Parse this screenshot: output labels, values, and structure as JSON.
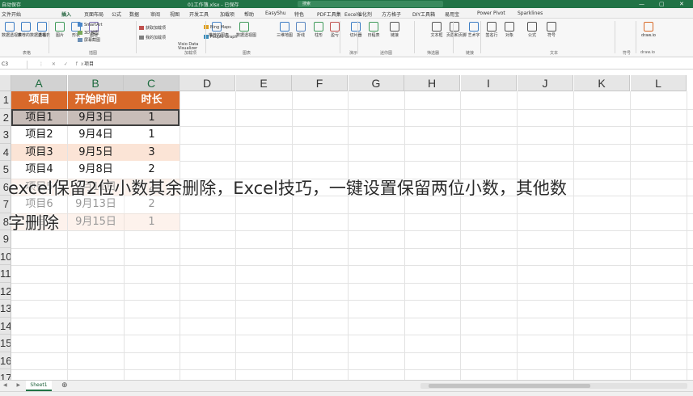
{
  "titlebar": {
    "left_text": "自动保存",
    "file_name": "01工作簿.xlsx - 已保存",
    "search_placeholder": "搜索",
    "minimize": "—",
    "restore": "▢",
    "close": "✕"
  },
  "tabs": [
    "文件",
    "开始",
    "插入",
    "页面布局",
    "公式",
    "数据",
    "审阅",
    "视图",
    "开发工具",
    "加载项",
    "帮助",
    "EasyShu",
    "特色",
    "PDF工具集",
    "Excel催化剂",
    "方方格子",
    "DIY工具箱",
    "易用宝",
    "Power Pivot",
    "Sparklines"
  ],
  "active_tab": "插入",
  "ribbon": {
    "buttons": [
      {
        "label": "数据透视表",
        "icon": "pivot-table-icon"
      },
      {
        "label": "推荐的数据透视表",
        "icon": "recommended-pivot-icon"
      },
      {
        "label": "表格",
        "icon": "table-icon"
      },
      {
        "label": "图片",
        "icon": "picture-icon"
      },
      {
        "label": "形状",
        "icon": "shapes-icon"
      },
      {
        "label": "图标",
        "icon": "icons-icon"
      },
      {
        "label": "推荐的图表",
        "icon": "recommended-chart-icon"
      },
      {
        "label": "数据透视图",
        "icon": "pivot-chart-icon"
      },
      {
        "label": "三维地图",
        "icon": "3d-map-icon"
      },
      {
        "label": "折线",
        "icon": "line-sparkline-icon"
      },
      {
        "label": "柱形",
        "icon": "column-sparkline-icon"
      },
      {
        "label": "盈亏",
        "icon": "winloss-sparkline-icon"
      },
      {
        "label": "切片器",
        "icon": "slicer-icon"
      },
      {
        "label": "日程表",
        "icon": "timeline-icon"
      },
      {
        "label": "链接",
        "icon": "link-icon"
      },
      {
        "label": "文本框",
        "icon": "textbox-icon"
      },
      {
        "label": "页眉和页脚",
        "icon": "header-footer-icon"
      },
      {
        "label": "艺术字",
        "icon": "wordart-icon"
      },
      {
        "label": "签名行",
        "icon": "signature-icon"
      },
      {
        "label": "对象",
        "icon": "object-icon"
      },
      {
        "label": "公式",
        "icon": "equation-icon"
      },
      {
        "label": "符号",
        "icon": "symbol-icon"
      },
      {
        "label": "draw.io",
        "icon": "drawio-icon"
      }
    ],
    "small_items": [
      "SmartArt",
      "3D 模型",
      "屏幕截图",
      "获取加载项",
      "我的加载项",
      "Visio Data Visualizer",
      "Bing Maps",
      "People Graph"
    ],
    "groups": [
      "表格",
      "插图",
      "加载项",
      "图表",
      "演示",
      "迷你图",
      "筛选器",
      "链接",
      "文本",
      "符号",
      "draw.io"
    ]
  },
  "formula_bar": {
    "name_box": "C3",
    "icons": "⋮ ✕ ✓ fx",
    "content": "项目"
  },
  "columns": [
    "A",
    "B",
    "C",
    "D",
    "E",
    "F",
    "G",
    "H",
    "I",
    "J",
    "K",
    "L"
  ],
  "rows": [
    "1",
    "2",
    "3",
    "4",
    "5",
    "6",
    "7",
    "8",
    "9",
    "10",
    "11",
    "12",
    "13",
    "14",
    "15",
    "16",
    "17"
  ],
  "table": {
    "headers": [
      "项目",
      "开始时间",
      "时长"
    ],
    "rows": [
      [
        "项目1",
        "9月3日",
        "1"
      ],
      [
        "项目2",
        "9月4日",
        "1"
      ],
      [
        "项目3",
        "9月5日",
        "3"
      ],
      [
        "项目4",
        "9月8日",
        "2"
      ],
      [
        "项目5",
        "9月11日",
        "2"
      ],
      [
        "项目6",
        "9月13日",
        "2"
      ],
      [
        "项目7",
        "9月15日",
        "1"
      ]
    ]
  },
  "caption": {
    "line1": "excel保留2位小数其余删除，Excel技巧，一键设置保留两位小数，其他数",
    "line2": "字删除"
  },
  "sheet": {
    "nav": "◀ ▶",
    "tab_name": "Sheet1",
    "add": "⊕"
  },
  "colors": {
    "excel_green": "#217346",
    "header_orange": "#d8692a",
    "row_peach": "#fbe4d6",
    "selected_row_grey": "#c8bdb8"
  }
}
